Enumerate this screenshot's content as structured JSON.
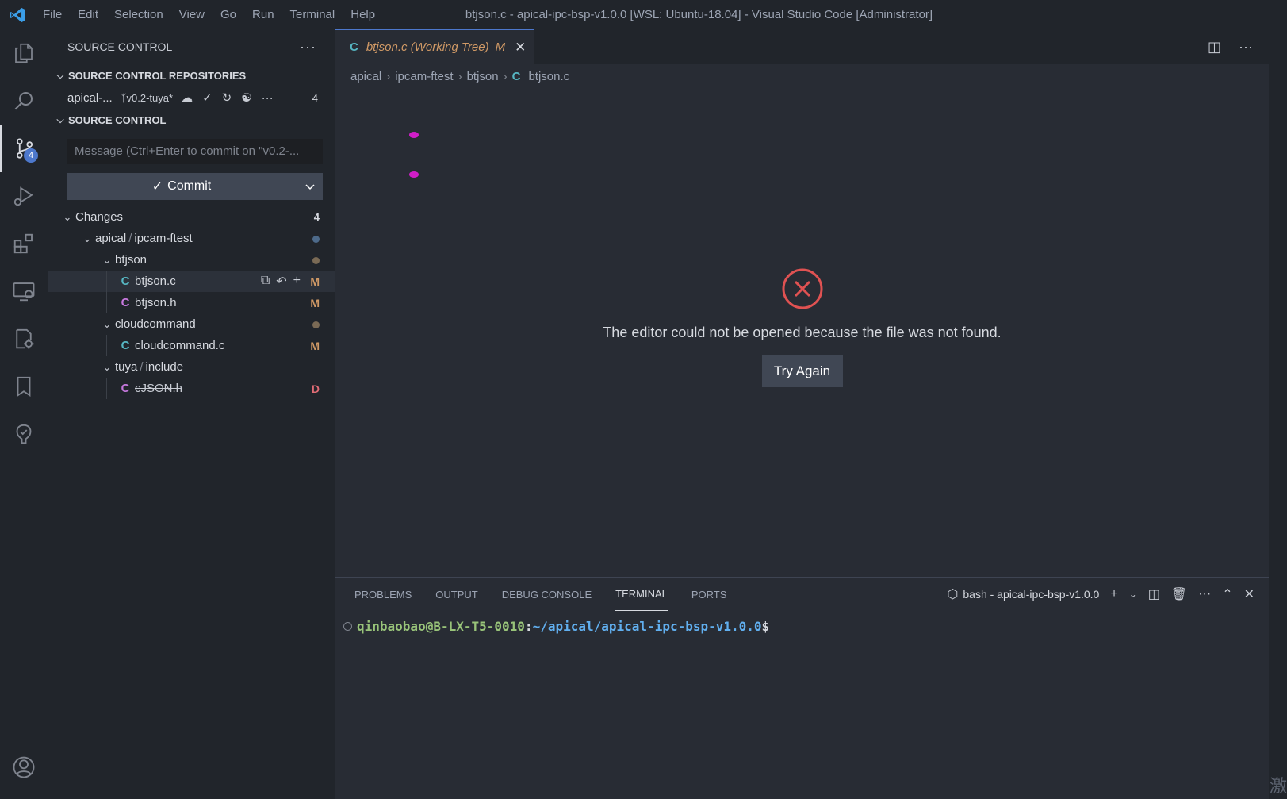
{
  "menu": [
    "File",
    "Edit",
    "Selection",
    "View",
    "Go",
    "Run",
    "Terminal",
    "Help"
  ],
  "window_title": "btjson.c - apical-ipc-bsp-v1.0.0 [WSL: Ubuntu-18.04] - Visual Studio Code [Administrator]",
  "activity": {
    "items": [
      "explorer-icon",
      "search-icon",
      "source-control-icon",
      "run-debug-icon",
      "extensions-icon",
      "remote-explorer-icon",
      "settings-sync-icon",
      "bookmarks-icon",
      "test-icon",
      "account-icon"
    ],
    "scm_badge": "4"
  },
  "sidebar": {
    "title": "SOURCE CONTROL",
    "more": "···",
    "repos_title": "SOURCE CONTROL REPOSITORIES",
    "repo": {
      "name": "apical-...",
      "branch": "v0.2-tuya*",
      "count": "4"
    },
    "scm_title": "SOURCE CONTROL",
    "commit_placeholder": "Message (Ctrl+Enter to commit on \"v0.2-...",
    "commit_label": "Commit",
    "changes": {
      "label": "Changes",
      "count": "4"
    },
    "tree": [
      {
        "label": "apical",
        "label2": "ipcam-ftest"
      },
      {
        "label": "btjson"
      },
      {
        "label": "btjson.c",
        "status": "M"
      },
      {
        "label": "btjson.h",
        "status": "M"
      },
      {
        "label": "cloudcommand"
      },
      {
        "label": "cloudcommand.c",
        "status": "M"
      },
      {
        "label": "tuya",
        "label2": "include"
      },
      {
        "label": "cJSON.h",
        "status": "D"
      }
    ],
    "slash": "/",
    "c_letter": "C"
  },
  "editor": {
    "tab": {
      "label": "btjson.c (Working Tree)",
      "status": "M"
    },
    "breadcrumbs": [
      "apical",
      "ipcam-ftest",
      "btjson",
      "btjson.c"
    ],
    "error_message": "The editor could not be opened because the file was not found.",
    "try_again": "Try Again"
  },
  "panel": {
    "tabs": [
      "PROBLEMS",
      "OUTPUT",
      "DEBUG CONSOLE",
      "TERMINAL",
      "PORTS"
    ],
    "terminal_name": "bash - apical-ipc-bsp-v1.0.0",
    "prompt_user": "qinbaobao@B-LX-T5-0010",
    "prompt_colon": ":",
    "prompt_path": "~/apical/apical-ipc-bsp-v1.0.0",
    "prompt_dollar": "$"
  },
  "corner_char": "激",
  "colors": {
    "accent": "#4d78cc",
    "modified": "#d19a66",
    "deleted": "#e06c75",
    "c_file": "#56b6c2",
    "h_file": "#c678dd",
    "error": "#e05252"
  }
}
